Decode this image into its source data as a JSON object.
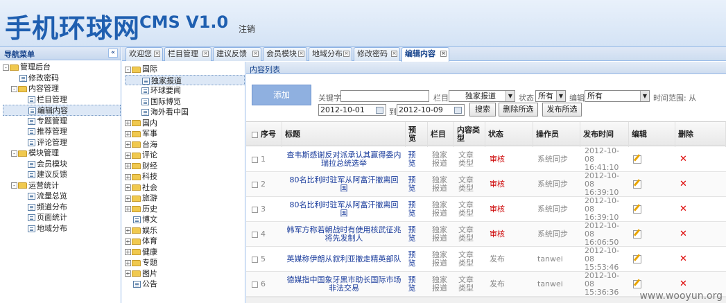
{
  "header": {
    "logo": "手机环球网",
    "version": "CMS V1.0",
    "logout": "注销"
  },
  "nav": {
    "title": "导航菜单",
    "collapse_icon": "«",
    "items": [
      {
        "label": "管理后台",
        "level": 0,
        "type": "folder",
        "exp": "-"
      },
      {
        "label": "修改密码",
        "level": 1,
        "type": "leaf"
      },
      {
        "label": "内容管理",
        "level": 1,
        "type": "folder",
        "exp": "-"
      },
      {
        "label": "栏目管理",
        "level": 2,
        "type": "leaf"
      },
      {
        "label": "编辑内容",
        "level": 2,
        "type": "leaf",
        "selected": true
      },
      {
        "label": "专题管理",
        "level": 2,
        "type": "leaf"
      },
      {
        "label": "推荐管理",
        "level": 2,
        "type": "leaf"
      },
      {
        "label": "评论管理",
        "level": 2,
        "type": "leaf"
      },
      {
        "label": "模块管理",
        "level": 1,
        "type": "folder",
        "exp": "-"
      },
      {
        "label": "会员模块",
        "level": 2,
        "type": "leaf"
      },
      {
        "label": "建议反馈",
        "level": 2,
        "type": "leaf"
      },
      {
        "label": "运营统计",
        "level": 1,
        "type": "folder",
        "exp": "-"
      },
      {
        "label": "流量总览",
        "level": 2,
        "type": "leaf"
      },
      {
        "label": "频道分布",
        "level": 2,
        "type": "leaf"
      },
      {
        "label": "页面统计",
        "level": 2,
        "type": "leaf"
      },
      {
        "label": "地域分布",
        "level": 2,
        "type": "leaf"
      }
    ]
  },
  "tabs": [
    {
      "label": "欢迎您"
    },
    {
      "label": "栏目管理"
    },
    {
      "label": "建议反馈"
    },
    {
      "label": "会员模块"
    },
    {
      "label": "地域分布"
    },
    {
      "label": "修改密码"
    },
    {
      "label": "编辑内容",
      "active": true
    }
  ],
  "category_tree": [
    {
      "label": "国际",
      "level": 0,
      "type": "folder",
      "exp": "-"
    },
    {
      "label": "独家报道",
      "level": 1,
      "type": "leaf",
      "selected": true
    },
    {
      "label": "环球要闻",
      "level": 1,
      "type": "leaf"
    },
    {
      "label": "国际博览",
      "level": 1,
      "type": "leaf"
    },
    {
      "label": "海外看中国",
      "level": 1,
      "type": "leaf"
    },
    {
      "label": "国内",
      "level": 0,
      "type": "folder",
      "exp": "+"
    },
    {
      "label": "军事",
      "level": 0,
      "type": "folder",
      "exp": "+"
    },
    {
      "label": "台海",
      "level": 0,
      "type": "folder",
      "exp": "+"
    },
    {
      "label": "评论",
      "level": 0,
      "type": "folder",
      "exp": "+"
    },
    {
      "label": "财经",
      "level": 0,
      "type": "folder",
      "exp": "+"
    },
    {
      "label": "科技",
      "level": 0,
      "type": "folder",
      "exp": "+"
    },
    {
      "label": "社会",
      "level": 0,
      "type": "folder",
      "exp": "+"
    },
    {
      "label": "旅游",
      "level": 0,
      "type": "folder",
      "exp": "+"
    },
    {
      "label": "历史",
      "level": 0,
      "type": "folder",
      "exp": "+"
    },
    {
      "label": "博文",
      "level": 0,
      "type": "leaf"
    },
    {
      "label": "娱乐",
      "level": 0,
      "type": "folder",
      "exp": "+"
    },
    {
      "label": "体育",
      "level": 0,
      "type": "folder",
      "exp": "+"
    },
    {
      "label": "健康",
      "level": 0,
      "type": "folder",
      "exp": "+"
    },
    {
      "label": "专题",
      "level": 0,
      "type": "folder",
      "exp": "+"
    },
    {
      "label": "图片",
      "level": 0,
      "type": "folder",
      "exp": "+"
    },
    {
      "label": "公告",
      "level": 0,
      "type": "leaf"
    }
  ],
  "content": {
    "panel_title": "内容列表",
    "add_label": "添加",
    "filter": {
      "keyword_label": "关键字",
      "keyword_value": "",
      "column_label": "栏目",
      "column_value": "独家报道",
      "status_label": "状态",
      "status_value": "所有",
      "editor_label": "编辑",
      "editor_value": "所有",
      "time_label": "时间范围:  从",
      "date_from": "2012-10-01",
      "to_label": "到",
      "date_to": "2012-10-09",
      "search_label": "搜索",
      "delete_selected_label": "删除所选",
      "publish_selected_label": "发布所选"
    },
    "columns": [
      "序号",
      "标题",
      "预览",
      "栏目",
      "内容类型",
      "状态",
      "操作员",
      "发布时间",
      "编辑",
      "删除"
    ],
    "rows": [
      {
        "no": "1",
        "title": "查韦斯感谢反对派承认其赢得委内瑞拉总统选举",
        "preview": "预览",
        "column": "独家报道",
        "type": "文章类型",
        "status": "审核",
        "operator": "系统同步",
        "time": "2012-10-08 16:41:10"
      },
      {
        "no": "2",
        "title": "80名比利时驻军从阿富汗撤离回国",
        "preview": "预览",
        "column": "独家报道",
        "type": "文章类型",
        "status": "审核",
        "operator": "系统同步",
        "time": "2012-10-08 16:39:10"
      },
      {
        "no": "3",
        "title": "80名比利时驻军从阿富汗撤离回国",
        "preview": "预览",
        "column": "独家报道",
        "type": "文章类型",
        "status": "审核",
        "operator": "系统同步",
        "time": "2012-10-08 16:39:10"
      },
      {
        "no": "4",
        "title": "韩军方称若朝战时有使用核武征兆将先发制人",
        "preview": "预览",
        "column": "独家报道",
        "type": "文章类型",
        "status": "审核",
        "operator": "系统同步",
        "time": "2012-10-08 16:06:50"
      },
      {
        "no": "5",
        "title": "英媒称伊朗从叙利亚撤走精英部队",
        "preview": "预览",
        "column": "独家报道",
        "type": "文章类型",
        "status": "发布",
        "operator": "tanwei",
        "time": "2012-10-08 15:53:46"
      },
      {
        "no": "6",
        "title": "德媒指中国象牙黑市助长国际市场非法交易",
        "preview": "预览",
        "column": "独家报道",
        "type": "文章类型",
        "status": "发布",
        "operator": "tanwei",
        "time": "2012-10-08 15:36:36"
      }
    ]
  },
  "watermark": "www.wooyun.org"
}
